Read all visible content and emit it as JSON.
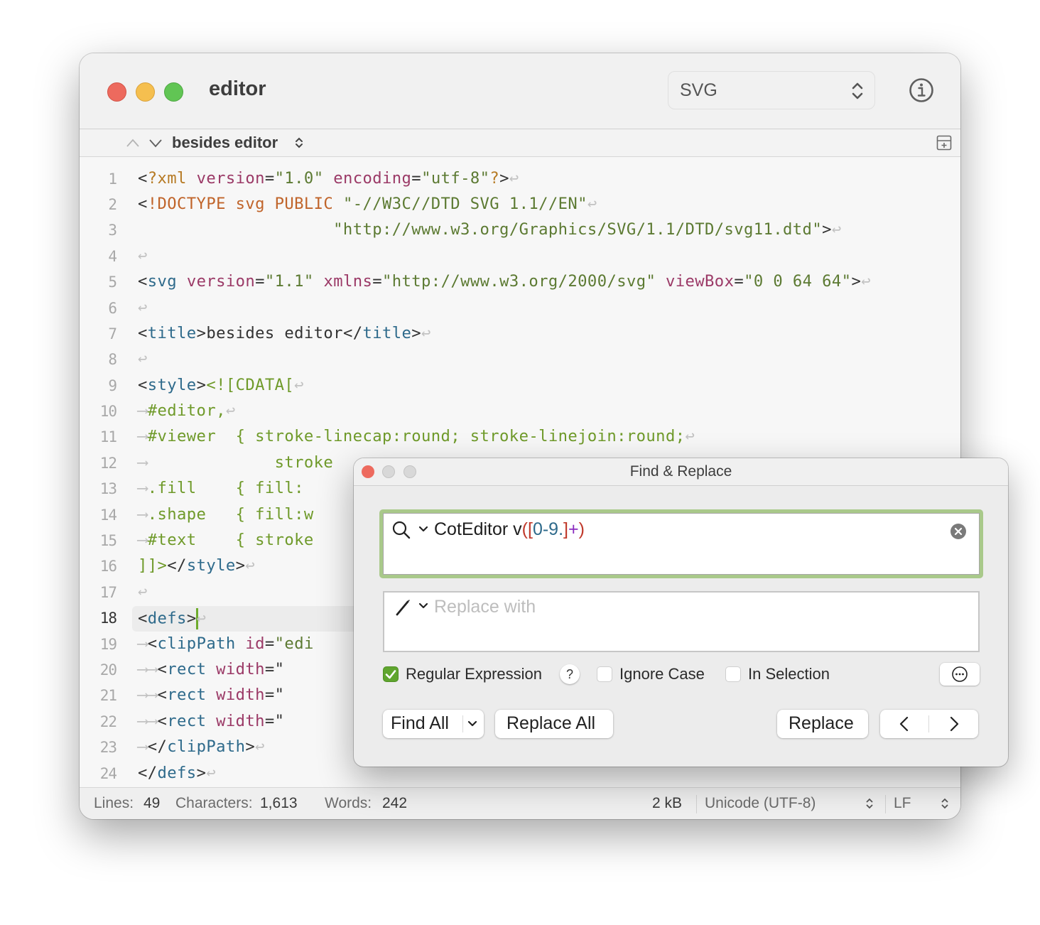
{
  "window": {
    "title": "editor",
    "syntax_style": "SVG",
    "outline_item": "besides editor"
  },
  "editor": {
    "current_line": 18,
    "lines": [
      {
        "n": "1"
      },
      {
        "n": "2"
      },
      {
        "n": "3"
      },
      {
        "n": "4"
      },
      {
        "n": "5"
      },
      {
        "n": "6"
      },
      {
        "n": "7"
      },
      {
        "n": "8"
      },
      {
        "n": "9"
      },
      {
        "n": "10"
      },
      {
        "n": "11"
      },
      {
        "n": "12"
      },
      {
        "n": "13"
      },
      {
        "n": "14"
      },
      {
        "n": "15"
      },
      {
        "n": "16"
      },
      {
        "n": "17"
      },
      {
        "n": "18"
      },
      {
        "n": "19"
      },
      {
        "n": "20"
      },
      {
        "n": "21"
      },
      {
        "n": "22"
      },
      {
        "n": "23"
      },
      {
        "n": "24"
      }
    ],
    "tokens": {
      "l1": [
        "<",
        "?xml",
        " ",
        "version",
        "=",
        "\"1.0\"",
        " ",
        "encoding",
        "=",
        "\"utf-8\"",
        "?",
        ">"
      ],
      "l2": [
        "<",
        "!DOCTYPE svg PUBLIC",
        " ",
        "\"-//W3C//DTD SVG 1.1//EN\""
      ],
      "l3": [
        "                    ",
        "\"http://www.w3.org/Graphics/SVG/1.1/DTD/svg11.dtd\"",
        ">"
      ],
      "l5": [
        "<",
        "svg",
        " ",
        "version",
        "=",
        "\"1.1\"",
        " ",
        "xmlns",
        "=",
        "\"http://www.w3.org/2000/svg\"",
        " ",
        "viewBox",
        "=",
        "\"0 0 64 64\"",
        ">"
      ],
      "l7": [
        "<",
        "title",
        ">",
        "besides editor",
        "</",
        "title",
        ">"
      ],
      "l9": [
        "<",
        "style",
        ">",
        "<![CDATA["
      ],
      "l10": [
        "#editor,"
      ],
      "l11": [
        "#viewer  { stroke-linecap:round; stroke-linejoin:round;"
      ],
      "l12": [
        "             stroke"
      ],
      "l13": [
        ".fill    { fill:"
      ],
      "l14": [
        ".shape   { fill:w"
      ],
      "l15": [
        "#text    { stroke"
      ],
      "l16": [
        "]]>",
        "</",
        "style",
        ">"
      ],
      "l18": [
        "<",
        "defs",
        ">"
      ],
      "l19": [
        "<",
        "clipPath",
        " ",
        "id",
        "=",
        "\"edi"
      ],
      "l20": [
        "<",
        "rect",
        " ",
        "width",
        "=\""
      ],
      "l21": [
        "<",
        "rect",
        " ",
        "width",
        "=\""
      ],
      "l22": [
        "<",
        "rect",
        " ",
        "width",
        "=\""
      ],
      "l23": [
        "</",
        "clipPath",
        ">"
      ],
      "l24": [
        "</",
        "defs",
        ">"
      ]
    },
    "invisibles": {
      "newline": "↩",
      "tab": "⟶"
    }
  },
  "statusbar": {
    "lines_label": "Lines:",
    "lines_value": "49",
    "chars_label": "Characters:",
    "chars_value": "1,613",
    "words_label": "Words:",
    "words_value": "242",
    "file_size": "2 kB",
    "encoding": "Unicode (UTF-8)",
    "line_ending": "LF"
  },
  "find_panel": {
    "title": "Find & Replace",
    "search": {
      "prefix": "CotEditor v",
      "p_open": "(",
      "b_open": "[",
      "range": "0-9.",
      "b_close": "]",
      "quant": "+",
      "p_close": ")"
    },
    "replace_placeholder": "Replace with",
    "options": {
      "regex_label": "Regular Expression",
      "regex_checked": true,
      "help_label": "?",
      "ignore_case_label": "Ignore Case",
      "ignore_case_checked": false,
      "in_selection_label": "In Selection",
      "in_selection_checked": false
    },
    "buttons": {
      "find_all": "Find All",
      "replace_all": "Replace All",
      "replace": "Replace"
    }
  },
  "colors": {
    "accent_green": "#5fa52e",
    "focus_ring": "#a9c98a",
    "tag": "#2e6a8b",
    "attribute": "#9b3a67",
    "string": "#5c7a32",
    "css": "#6f9a2a"
  }
}
